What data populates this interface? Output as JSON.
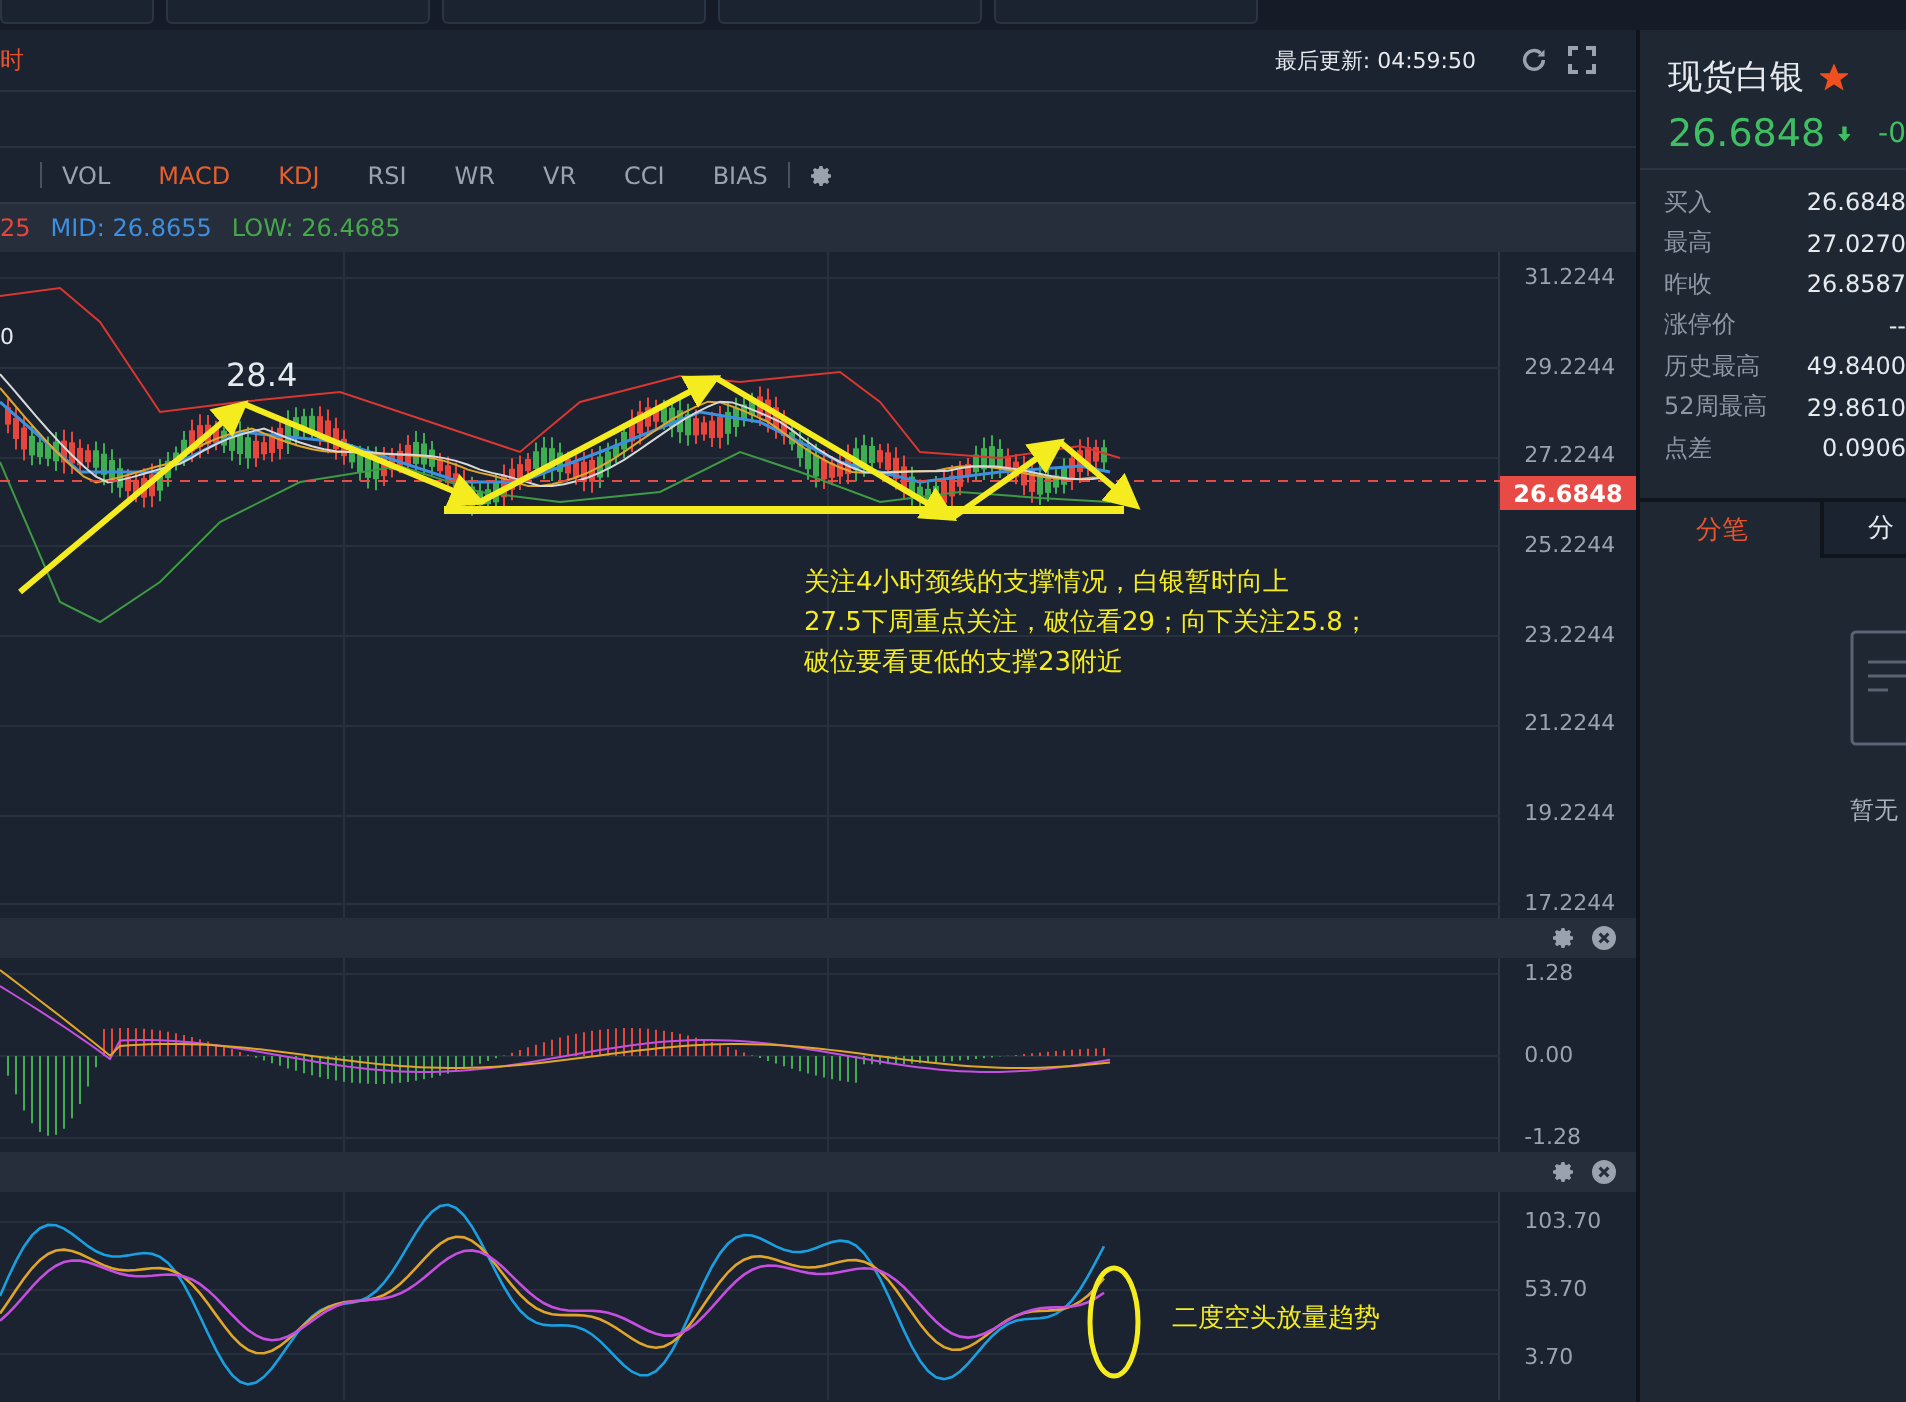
{
  "chart_header": {
    "period": "时",
    "updated": "最后更新: 04:59:50"
  },
  "indicators": [
    {
      "label": "VOL",
      "selected": false
    },
    {
      "label": "MACD",
      "selected": true
    },
    {
      "label": "KDJ",
      "selected": true
    },
    {
      "label": "RSI",
      "selected": false
    },
    {
      "label": "WR",
      "selected": false
    },
    {
      "label": "VR",
      "selected": false
    },
    {
      "label": "CCI",
      "selected": false
    },
    {
      "label": "BIAS",
      "selected": false
    }
  ],
  "legend": [
    {
      "text": "25",
      "color": "#e8453c"
    },
    {
      "text": "MID: 26.8655",
      "color": "#3d8fe0"
    },
    {
      "text": "LOW: 26.4685",
      "color": "#45a84a"
    }
  ],
  "price_axis": [
    "31.2244",
    "29.2244",
    "27.2244",
    "25.2244",
    "23.2244",
    "21.2244",
    "19.2244",
    "17.2244"
  ],
  "last_price_tag": "26.6848",
  "annotations": {
    "edge_label": "0",
    "peak_label": "28.4",
    "note": [
      "关注4小时颈线的支撑情况，白银暂时向上",
      "27.5下周重点关注，破位看29；向下关注25.8；",
      "破位要看更低的支撑23附近"
    ],
    "kdj_note": "二度空头放量趋势"
  },
  "macd_axis": [
    "1.28",
    "0.00",
    "-1.28"
  ],
  "kdj_axis": [
    "103.70",
    "53.70",
    "3.70"
  ],
  "quote": {
    "name": "现货白银",
    "favorite": true,
    "price": "26.6848",
    "change": "-0",
    "stats": [
      {
        "label": "买入",
        "value": "26.6848"
      },
      {
        "label": "最高",
        "value": "27.0270"
      },
      {
        "label": "昨收",
        "value": "26.8587"
      },
      {
        "label": "涨停价",
        "value": "--"
      },
      {
        "label": "历史最高",
        "value": "49.8400"
      },
      {
        "label": "52周最高",
        "value": "29.8610"
      },
      {
        "label": "点差",
        "value": "0.0906"
      }
    ],
    "tabs": [
      {
        "label": "分笔",
        "selected": true
      },
      {
        "label": "分",
        "selected": false
      }
    ],
    "empty_text": "暂无"
  }
}
